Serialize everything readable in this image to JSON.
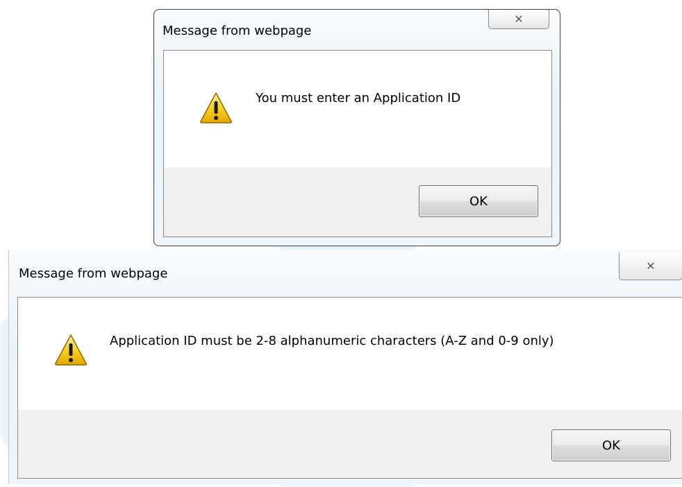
{
  "dialogs": [
    {
      "title": "Message from webpage",
      "close_glyph": "✕",
      "icon": "warning-triangle-icon",
      "message": "You must enter an Application ID",
      "ok_label": "OK"
    },
    {
      "title": "Message from webpage",
      "close_glyph": "✕",
      "icon": "warning-triangle-icon",
      "message": "Application ID must be 2-8 alphanumeric characters (A-Z and 0-9 only)",
      "ok_label": "OK"
    }
  ],
  "colors": {
    "frame_glass": "#e9f3fa",
    "footer": "#f0f0f0",
    "warning_fill": "#f5c400",
    "warning_border": "#8a6a00"
  }
}
